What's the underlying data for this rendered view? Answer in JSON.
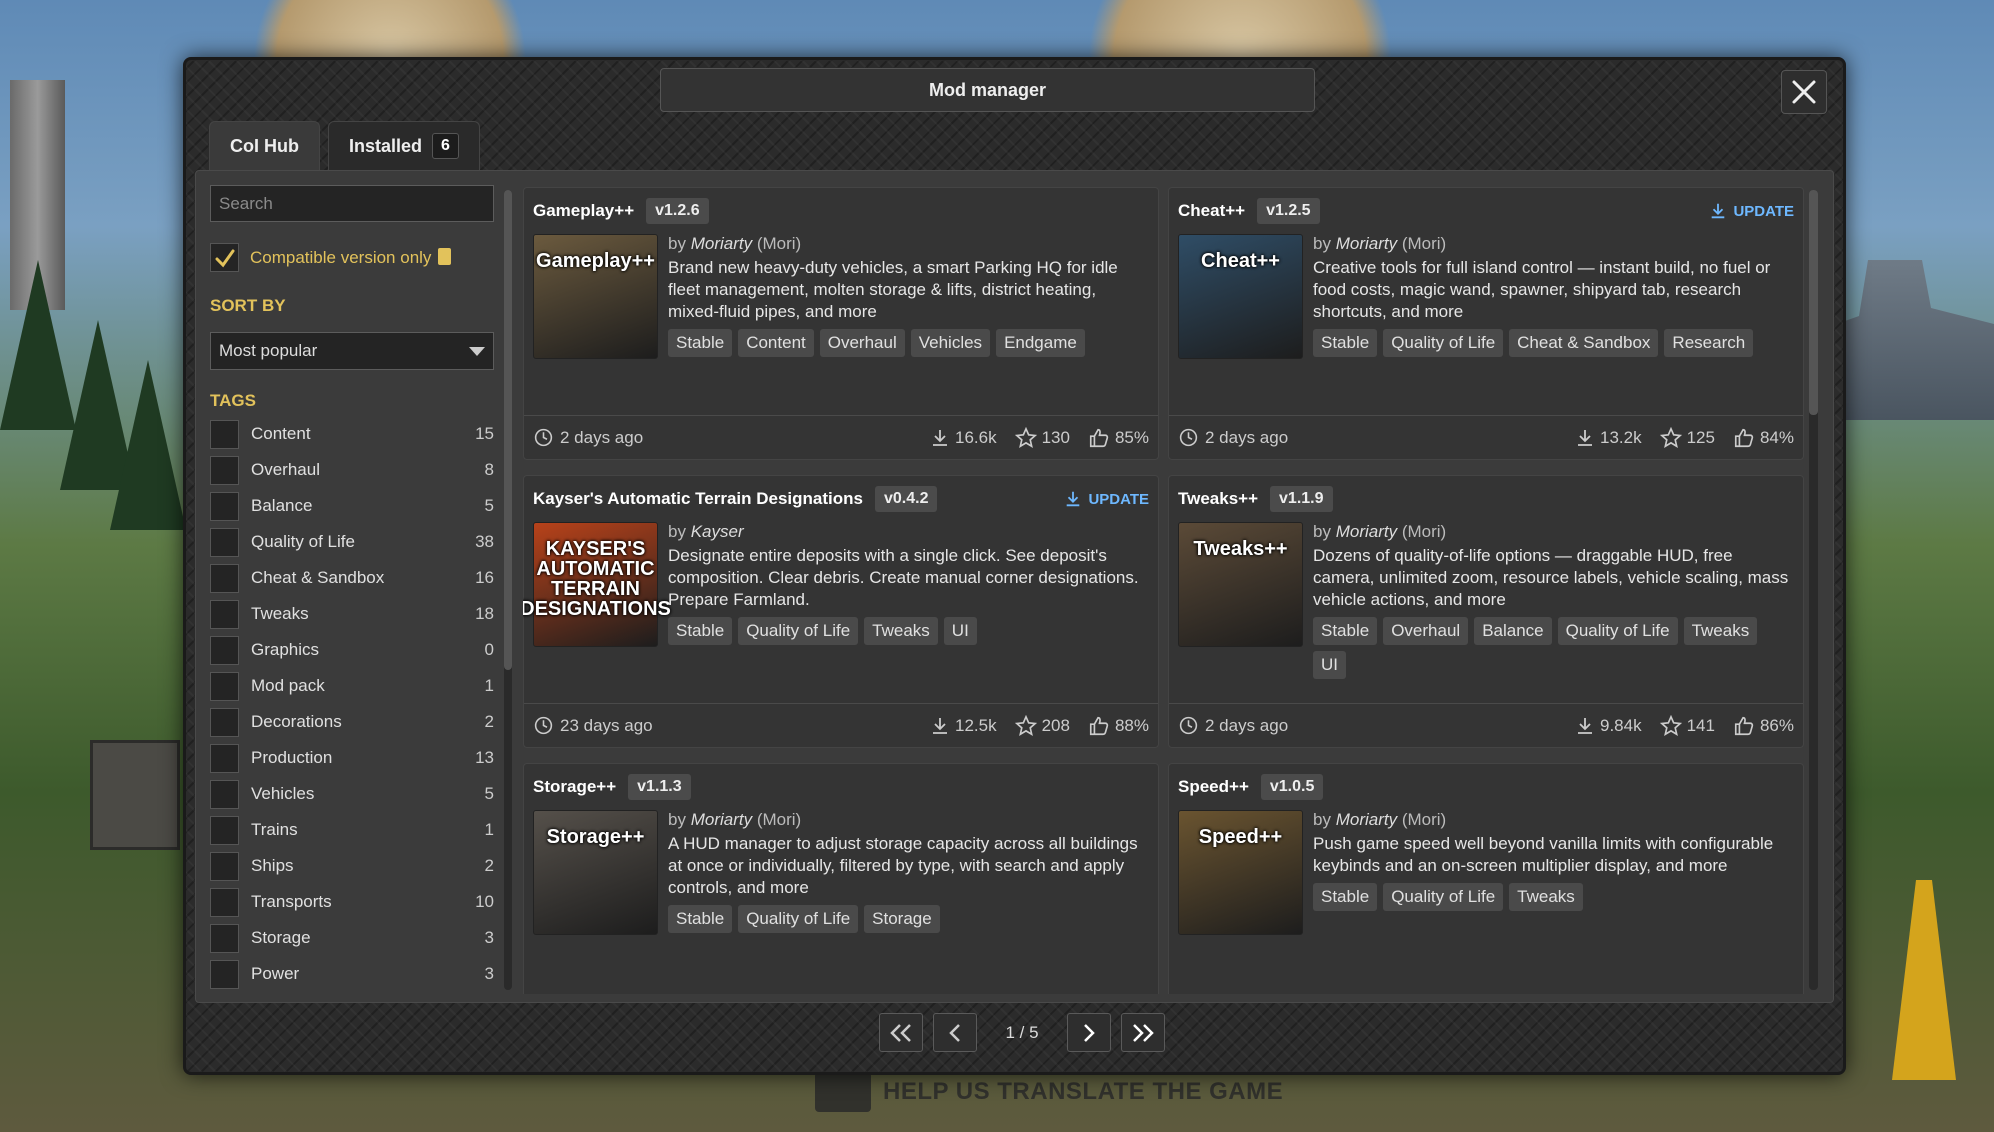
{
  "background": {
    "help_text": "HELP US TRANSLATE THE GAME"
  },
  "dialog": {
    "title": "Mod manager"
  },
  "tabs": [
    {
      "label": "CoI Hub",
      "active": true
    },
    {
      "label": "Installed",
      "count": "6"
    }
  ],
  "sidebar": {
    "search_placeholder": "Search",
    "compatible_label": "Compatible version only",
    "compatible_checked": true,
    "sort_by_label": "SORT BY",
    "sort_value": "Most popular",
    "tags_label": "TAGS",
    "tags": [
      {
        "name": "Content",
        "count": "15"
      },
      {
        "name": "Overhaul",
        "count": "8"
      },
      {
        "name": "Balance",
        "count": "5"
      },
      {
        "name": "Quality of Life",
        "count": "38"
      },
      {
        "name": "Cheat & Sandbox",
        "count": "16"
      },
      {
        "name": "Tweaks",
        "count": "18"
      },
      {
        "name": "Graphics",
        "count": "0"
      },
      {
        "name": "Mod pack",
        "count": "1"
      },
      {
        "name": "Decorations",
        "count": "2"
      },
      {
        "name": "Production",
        "count": "13"
      },
      {
        "name": "Vehicles",
        "count": "5"
      },
      {
        "name": "Trains",
        "count": "1"
      },
      {
        "name": "Ships",
        "count": "2"
      },
      {
        "name": "Transports",
        "count": "10"
      },
      {
        "name": "Storage",
        "count": "3"
      },
      {
        "name": "Power",
        "count": "3"
      }
    ]
  },
  "mods": [
    {
      "title": "Gameplay++",
      "version": "v1.2.6",
      "update": "",
      "thumb_text": "Gameplay++",
      "thumb_color": "#6b5a3e",
      "author_prefix": "by",
      "author": "Moriarty",
      "author_alias": "(Mori)",
      "description": "Brand new heavy-duty vehicles, a smart Parking HQ for idle fleet management, molten storage & lifts, district heating, mixed-fluid pipes, and more",
      "tags": [
        "Stable",
        "Content",
        "Overhaul",
        "Vehicles",
        "Endgame"
      ],
      "date": "2 days ago",
      "downloads": "16.6k",
      "stars": "130",
      "rating": "85%"
    },
    {
      "title": "Cheat++",
      "version": "v1.2.5",
      "update": "UPDATE",
      "thumb_text": "Cheat++",
      "thumb_color": "#2f4d66",
      "author_prefix": "by",
      "author": "Moriarty",
      "author_alias": "(Mori)",
      "description": "Creative tools for full island control — instant build, no fuel or food costs, magic wand, spawner, shipyard tab, research shortcuts, and more",
      "tags": [
        "Stable",
        "Quality of Life",
        "Cheat & Sandbox",
        "Research"
      ],
      "date": "2 days ago",
      "downloads": "13.2k",
      "stars": "125",
      "rating": "84%"
    },
    {
      "title": "Kayser's Automatic Terrain Designations",
      "version": "v0.4.2",
      "update": "UPDATE",
      "thumb_text": "KAYSER'S AUTOMATIC TERRAIN DESIGNATIONS",
      "thumb_color": "#b8421a",
      "author_prefix": "by",
      "author": "Kayser",
      "author_alias": "",
      "description": "Designate entire deposits with a single click. See deposit's composition. Clear debris. Create manual corner designations. Prepare Farmland.",
      "tags": [
        "Stable",
        "Quality of Life",
        "Tweaks",
        "UI"
      ],
      "date": "23 days ago",
      "downloads": "12.5k",
      "stars": "208",
      "rating": "88%"
    },
    {
      "title": "Tweaks++",
      "version": "v1.1.9",
      "update": "",
      "thumb_text": "Tweaks++",
      "thumb_color": "#5b4a37",
      "author_prefix": "by",
      "author": "Moriarty",
      "author_alias": "(Mori)",
      "description": "Dozens of quality-of-life options — draggable HUD, free camera, unlimited zoom, resource labels, vehicle scaling, mass vehicle actions, and more",
      "tags": [
        "Stable",
        "Overhaul",
        "Balance",
        "Quality of Life",
        "Tweaks",
        "UI"
      ],
      "date": "2 days ago",
      "downloads": "9.84k",
      "stars": "141",
      "rating": "86%"
    },
    {
      "title": "Storage++",
      "version": "v1.1.3",
      "update": "",
      "thumb_text": "Storage++",
      "thumb_color": "#55504a",
      "author_prefix": "by",
      "author": "Moriarty",
      "author_alias": "(Mori)",
      "description": "A HUD manager to adjust storage capacity across all buildings at once or individually, filtered by type, with search and apply controls, and more",
      "tags": [
        "Stable",
        "Quality of Life",
        "Storage"
      ],
      "date": "",
      "downloads": "",
      "stars": "",
      "rating": ""
    },
    {
      "title": "Speed++",
      "version": "v1.0.5",
      "update": "",
      "thumb_text": "Speed++",
      "thumb_color": "#6a5430",
      "author_prefix": "by",
      "author": "Moriarty",
      "author_alias": "(Mori)",
      "description": "Push game speed well beyond vanilla limits with configurable keybinds and an on-screen multiplier display, and more",
      "tags": [
        "Stable",
        "Quality of Life",
        "Tweaks"
      ],
      "date": "",
      "downloads": "",
      "stars": "",
      "rating": ""
    }
  ],
  "pagination": {
    "label": "1 / 5"
  }
}
